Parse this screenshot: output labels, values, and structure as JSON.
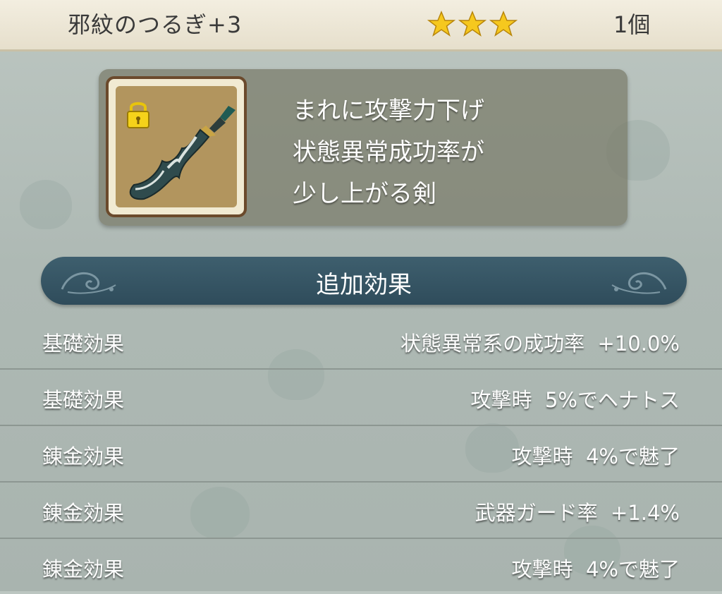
{
  "header": {
    "title": "邪紋のつるぎ+3",
    "star_count": 3,
    "count": "1個"
  },
  "item": {
    "icon": "sword-icon",
    "locked": true,
    "description": [
      "まれに攻撃力下げ",
      "状態異常成功率が",
      "少し上がる剣"
    ]
  },
  "effects": {
    "title": "追加効果",
    "rows": [
      {
        "label": "基礎効果",
        "value": "状態異常系の成功率  +10.0%"
      },
      {
        "label": "基礎効果",
        "value": "攻撃時  5%でヘナトス"
      },
      {
        "label": "錬金効果",
        "value": "攻撃時  4%で魅了"
      },
      {
        "label": "錬金効果",
        "value": "武器ガード率  +1.4%"
      },
      {
        "label": "錬金効果",
        "value": "攻撃時  4%で魅了"
      }
    ]
  },
  "colors": {
    "star": "#f6c81e",
    "banner": "#34525f",
    "header_bg": "#ede7d5"
  }
}
